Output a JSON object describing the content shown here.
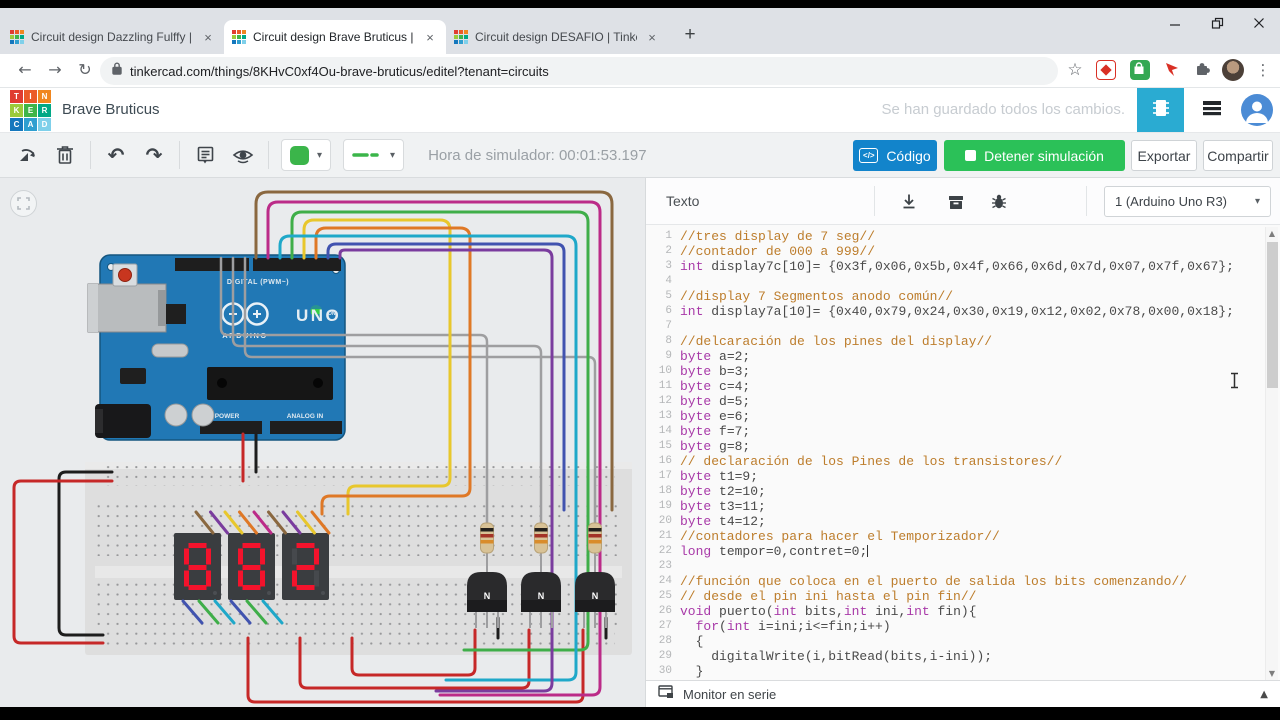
{
  "browser": {
    "tabs": [
      {
        "title": "Circuit design Dazzling Fulffy | Ti"
      },
      {
        "title": "Circuit design Brave Bruticus | Ti"
      },
      {
        "title": "Circuit design DESAFIO | Tinkerc"
      }
    ],
    "url": "tinkercad.com/things/8KHvC0xf4Ou-brave-bruticus/editel?tenant=circuits"
  },
  "header": {
    "logo_letters": [
      "T",
      "I",
      "N",
      "K",
      "E",
      "R",
      "C",
      "A",
      "D"
    ],
    "title": "Brave Bruticus",
    "save_status": "Se han guardado todos los cambios."
  },
  "toolbar": {
    "sim_time": "Hora de simulador: 00:01:53.197",
    "code": "Código",
    "code_icon": "</>",
    "stop": "Detener simulación",
    "export": "Exportar",
    "share": "Compartir"
  },
  "code_panel": {
    "mode": "Texto",
    "board": "1 (Arduino Uno R3)",
    "monitor": "Monitor en serie",
    "lines": [
      {
        "n": 1,
        "t": [
          [
            "c",
            "//tres display de 7 seg//"
          ]
        ]
      },
      {
        "n": 2,
        "t": [
          [
            "c",
            "//contador de 000 a 999//"
          ]
        ]
      },
      {
        "n": 3,
        "t": [
          [
            "k",
            "int"
          ],
          [
            "p",
            " display7c[10]= {0x3f,0x06,0x5b,0x4f,0x66,0x6d,0x7d,0x07,0x7f,0x67};"
          ]
        ]
      },
      {
        "n": 4,
        "t": []
      },
      {
        "n": 5,
        "t": [
          [
            "c",
            "//display 7 Segmentos anodo común//"
          ]
        ]
      },
      {
        "n": 6,
        "t": [
          [
            "k",
            "int"
          ],
          [
            "p",
            " display7a[10]= {0x40,0x79,0x24,0x30,0x19,0x12,0x02,0x78,0x00,0x18};"
          ]
        ]
      },
      {
        "n": 7,
        "t": []
      },
      {
        "n": 8,
        "t": [
          [
            "c",
            "//delcaración de los pines del display//"
          ]
        ]
      },
      {
        "n": 9,
        "t": [
          [
            "k",
            "byte"
          ],
          [
            "p",
            " a=2;"
          ]
        ]
      },
      {
        "n": 10,
        "t": [
          [
            "k",
            "byte"
          ],
          [
            "p",
            " b=3;"
          ]
        ]
      },
      {
        "n": 11,
        "t": [
          [
            "k",
            "byte"
          ],
          [
            "p",
            " c=4;"
          ]
        ]
      },
      {
        "n": 12,
        "t": [
          [
            "k",
            "byte"
          ],
          [
            "p",
            " d=5;"
          ]
        ]
      },
      {
        "n": 13,
        "t": [
          [
            "k",
            "byte"
          ],
          [
            "p",
            " e=6;"
          ]
        ]
      },
      {
        "n": 14,
        "t": [
          [
            "k",
            "byte"
          ],
          [
            "p",
            " f=7;"
          ]
        ]
      },
      {
        "n": 15,
        "t": [
          [
            "k",
            "byte"
          ],
          [
            "p",
            " g=8;"
          ]
        ]
      },
      {
        "n": 16,
        "t": [
          [
            "c",
            "// declaración de los Pines de los transistores//"
          ]
        ]
      },
      {
        "n": 17,
        "t": [
          [
            "k",
            "byte"
          ],
          [
            "p",
            " t1=9;"
          ]
        ]
      },
      {
        "n": 18,
        "t": [
          [
            "k",
            "byte"
          ],
          [
            "p",
            " t2=10;"
          ]
        ]
      },
      {
        "n": 19,
        "t": [
          [
            "k",
            "byte"
          ],
          [
            "p",
            " t3=11;"
          ]
        ]
      },
      {
        "n": 20,
        "t": [
          [
            "k",
            "byte"
          ],
          [
            "p",
            " t4=12;"
          ]
        ]
      },
      {
        "n": 21,
        "t": [
          [
            "c",
            "//contadores para hacer el Temporizador//"
          ]
        ]
      },
      {
        "n": 22,
        "t": [
          [
            "k",
            "long"
          ],
          [
            "p",
            " tempor=0,contret=0;"
          ],
          [
            "caret",
            ""
          ]
        ]
      },
      {
        "n": 23,
        "t": []
      },
      {
        "n": 24,
        "t": [
          [
            "c",
            "//función que coloca en el puerto de salida los bits comenzando//"
          ]
        ]
      },
      {
        "n": 25,
        "t": [
          [
            "c",
            "// desde el pin ini hasta el pin fin//"
          ]
        ]
      },
      {
        "n": 26,
        "t": [
          [
            "k",
            "void"
          ],
          [
            "p",
            " puerto("
          ],
          [
            "k",
            "int"
          ],
          [
            "p",
            " bits,"
          ],
          [
            "k",
            "int"
          ],
          [
            "p",
            " ini,"
          ],
          [
            "k",
            "int"
          ],
          [
            "p",
            " fin){"
          ]
        ]
      },
      {
        "n": 27,
        "t": [
          [
            "p",
            "  "
          ],
          [
            "k",
            "for"
          ],
          [
            "p",
            "("
          ],
          [
            "k",
            "int"
          ],
          [
            "p",
            " i=ini;i<=fin;i++)"
          ]
        ]
      },
      {
        "n": 28,
        "t": [
          [
            "p",
            "  {"
          ]
        ]
      },
      {
        "n": 29,
        "t": [
          [
            "p",
            "    digitalWrite(i,bitRead(bits,i-ini));"
          ]
        ]
      },
      {
        "n": 30,
        "t": [
          [
            "p",
            "  }"
          ]
        ]
      }
    ]
  },
  "circuit": {
    "board_label": "UNO",
    "brand": "ARDUINO",
    "digital_label": "DIGITAL (PWM~)",
    "power_label": "POWER",
    "analog_label": "ANALOG IN",
    "on_label": "ON",
    "transistor_label": "N",
    "display_digits": [
      "8",
      "8",
      "2"
    ],
    "wire_colors": {
      "brown": "#8a6840",
      "magenta": "#bb2b88",
      "green": "#3fae49",
      "yellow": "#e8c72c",
      "orange": "#df7826",
      "cyan": "#1fa8c9",
      "blue": "#4153af",
      "purple": "#7a3c9e",
      "gray": "#9e9ea0",
      "red": "#c62828",
      "black": "#1d1d1d"
    }
  },
  "colors": {
    "accent_blue": "#1284cb",
    "accent_green": "#2bc158",
    "mode_button_blue": "#2aabd2",
    "segment_on": "#f3132c",
    "segment_off": "#46494d",
    "syntax_comment": "#bd7d2c",
    "syntax_keyword": "#a839a8",
    "syntax_plain": "#4a4a4a"
  }
}
